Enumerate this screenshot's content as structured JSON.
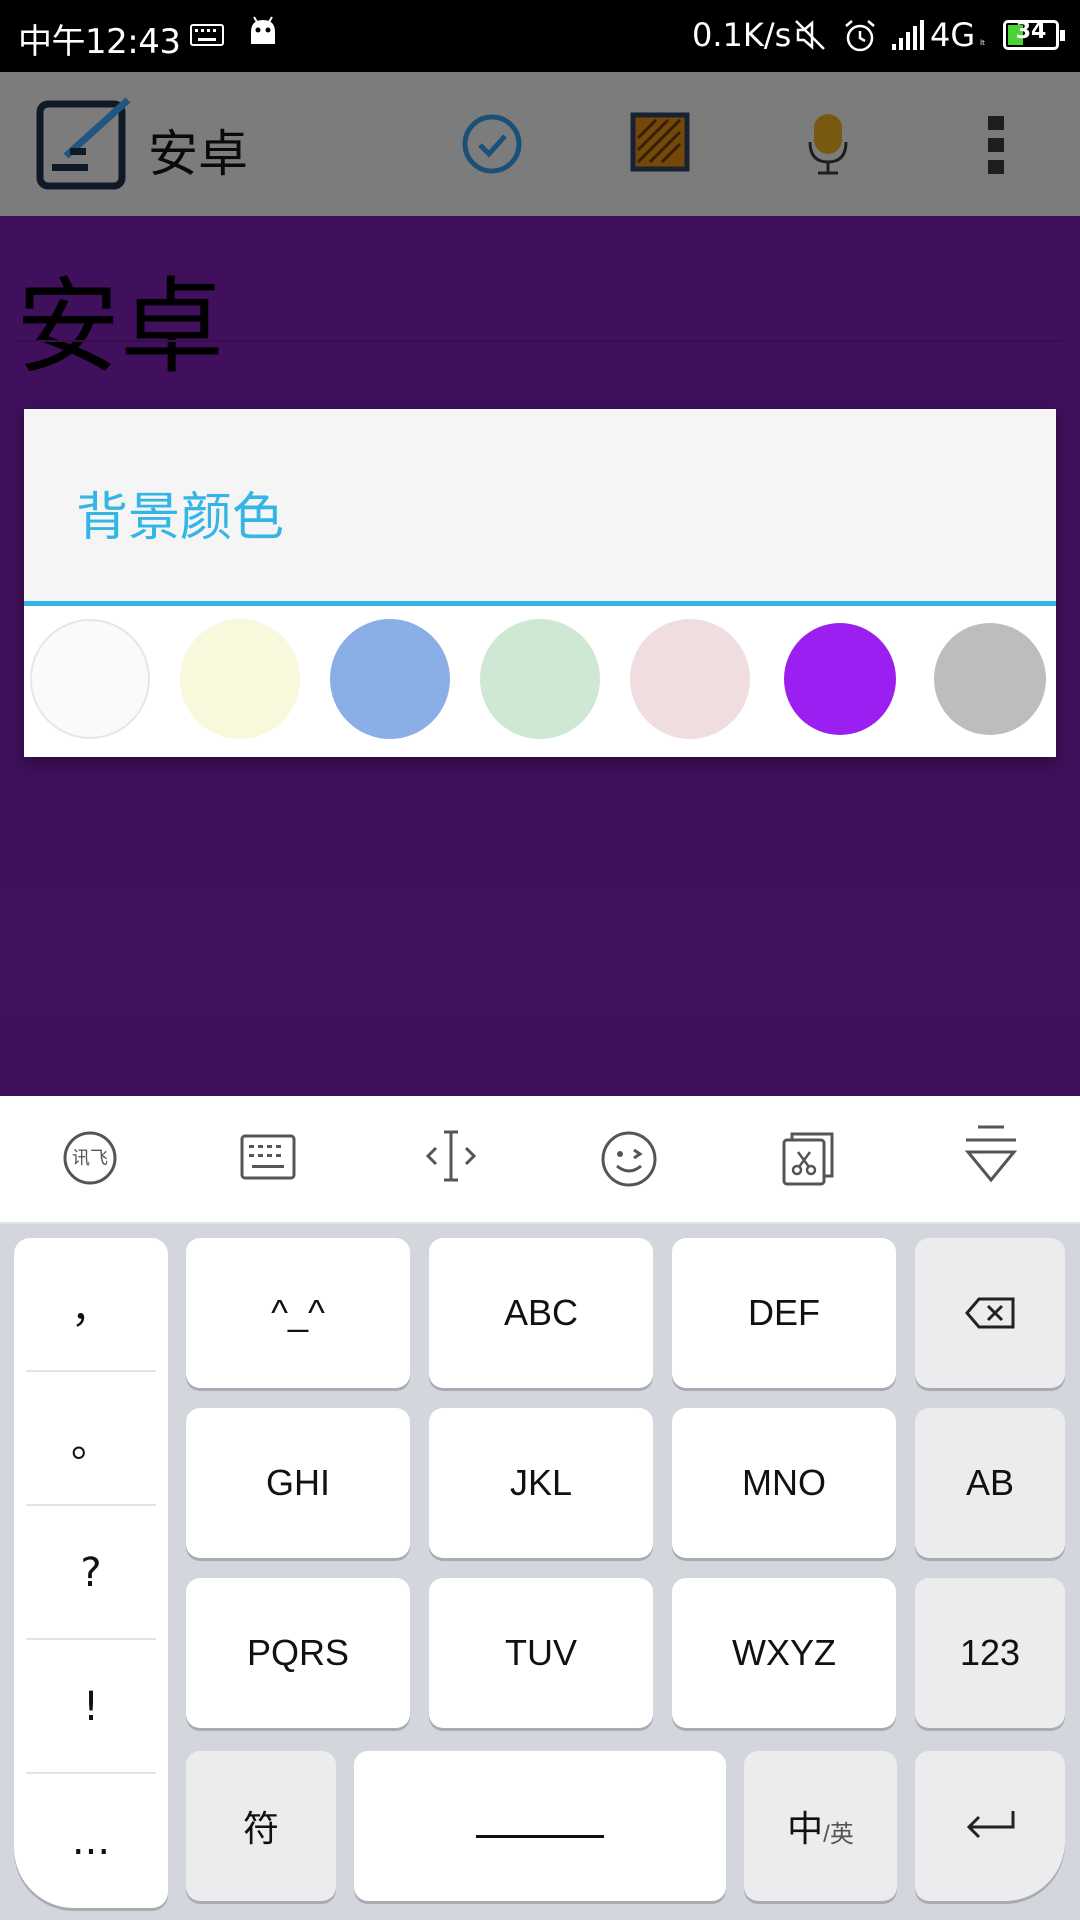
{
  "status_bar": {
    "time": "中午12:43",
    "speed": "0.1K/s",
    "network": "4G",
    "network_sub": "ₗₜ",
    "battery": "34",
    "icons": [
      "keyboard-icon",
      "android-icon",
      "mute-icon",
      "alarm-icon",
      "signal-icon",
      "battery-icon"
    ]
  },
  "toolbar": {
    "app_title": "安卓",
    "icons": [
      "app-logo-icon",
      "check-icon",
      "image-frame-icon",
      "microphone-icon",
      "overflow-menu-icon"
    ]
  },
  "editor": {
    "note_title": "安卓"
  },
  "dialog": {
    "title": "背景颜色",
    "swatches": [
      {
        "name": "white",
        "color": "#fafafa"
      },
      {
        "name": "light-yellow",
        "color": "#f8f8dc"
      },
      {
        "name": "blue",
        "color": "#8aaee6"
      },
      {
        "name": "light-green",
        "color": "#cfe8d3"
      },
      {
        "name": "light-pink",
        "color": "#f0dde0"
      },
      {
        "name": "purple",
        "color": "#9b1ff0"
      },
      {
        "name": "gray",
        "color": "#bdbdbd"
      }
    ]
  },
  "keyboard_toolbar": {
    "icons": [
      "ifly-logo-icon",
      "keyboard-layout-icon",
      "cursor-move-icon",
      "emoji-icon",
      "clipboard-icon",
      "hide-keyboard-icon"
    ]
  },
  "keyboard": {
    "punctuation": [
      "，",
      "。",
      "?",
      "!",
      "..."
    ],
    "keys": {
      "k1": "^_^",
      "k2": "ABC",
      "k3": "DEF",
      "k4": "GHI",
      "k5": "JKL",
      "k6": "MNO",
      "k7": "PQRS",
      "k8": "TUV",
      "k9": "WXYZ"
    },
    "right": {
      "uppercase": "AB",
      "numbers": "123"
    },
    "bottom": {
      "symbols": "符",
      "lang_main": "中",
      "lang_sub": "/英"
    }
  }
}
